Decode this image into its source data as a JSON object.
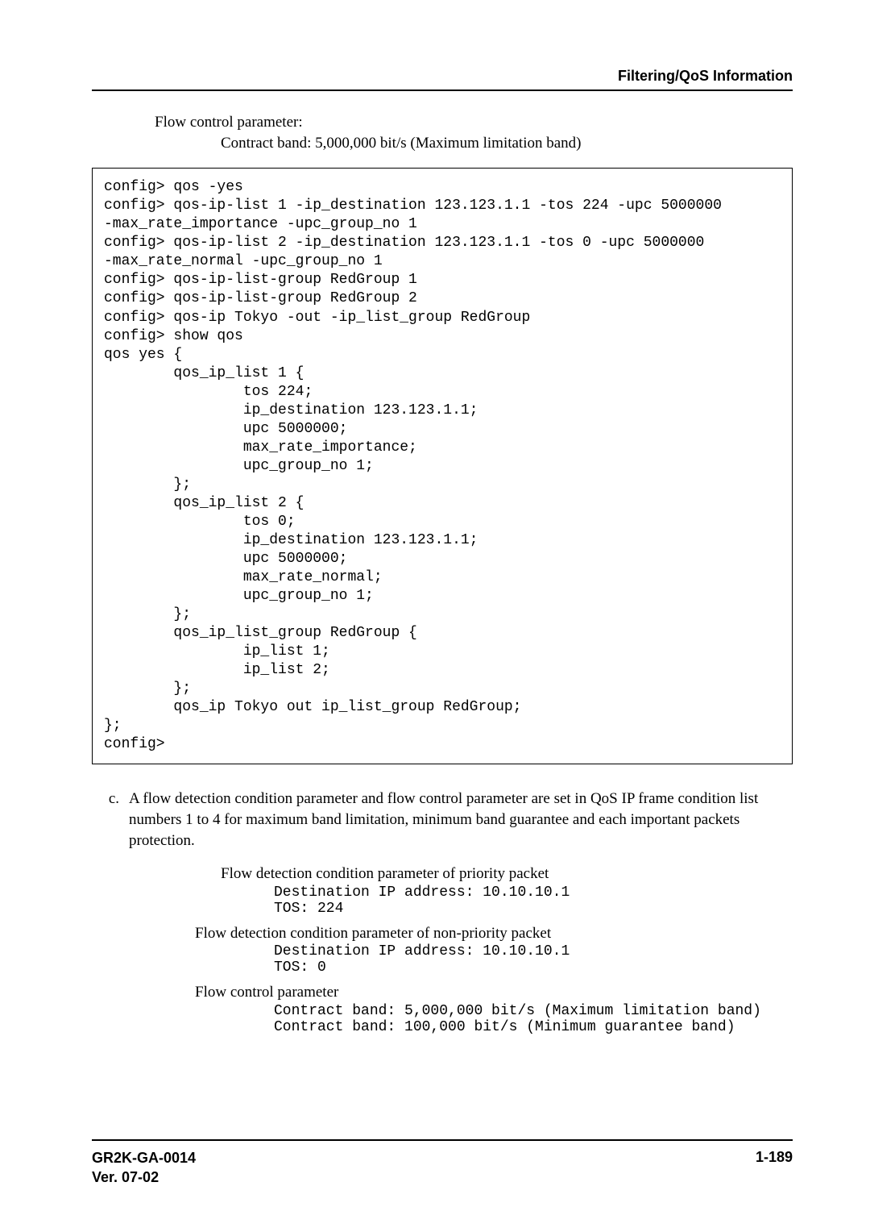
{
  "header": {
    "running_head": "Filtering/QoS Information"
  },
  "intro": {
    "line1": "Flow control parameter:",
    "line2": "Contract band: 5,000,000 bit/s (Maximum limitation band)"
  },
  "code1": "config> qos -yes\nconfig> qos-ip-list 1 -ip_destination 123.123.1.1 -tos 224 -upc 5000000\n-max_rate_importance -upc_group_no 1\nconfig> qos-ip-list 2 -ip_destination 123.123.1.1 -tos 0 -upc 5000000\n-max_rate_normal -upc_group_no 1\nconfig> qos-ip-list-group RedGroup 1\nconfig> qos-ip-list-group RedGroup 2\nconfig> qos-ip Tokyo -out -ip_list_group RedGroup\nconfig> show qos\nqos yes {\n        qos_ip_list 1 {\n                tos 224;\n                ip_destination 123.123.1.1;\n                upc 5000000;\n                max_rate_importance;\n                upc_group_no 1;\n        };\n        qos_ip_list 2 {\n                tos 0;\n                ip_destination 123.123.1.1;\n                upc 5000000;\n                max_rate_normal;\n                upc_group_no 1;\n        };\n        qos_ip_list_group RedGroup {\n                ip_list 1;\n                ip_list 2;\n        };\n        qos_ip Tokyo out ip_list_group RedGroup;\n};\nconfig>",
  "item_c": {
    "label": "c.",
    "text": "A flow detection condition parameter and flow control parameter are set in QoS IP frame condition list numbers 1 to 4 for maximum band limitation, minimum band guarantee and each important packets protection."
  },
  "after_c": {
    "g1_title": "Flow detection condition parameter of priority packet",
    "g1_l1": "Destination IP address: 10.10.10.1",
    "g1_l2": "TOS: 224",
    "g2_title": "Flow detection condition parameter of non-priority packet",
    "g2_l1": "Destination IP address: 10.10.10.1",
    "g2_l2": "TOS: 0",
    "g3_title": "Flow control parameter",
    "g3_l1": "Contract band: 5,000,000 bit/s (Maximum limitation band)",
    "g3_l2": "Contract band: 100,000 bit/s (Minimum guarantee band)"
  },
  "footer": {
    "doc_id": "GR2K-GA-0014",
    "version": "Ver. 07-02",
    "page": "1-189"
  }
}
